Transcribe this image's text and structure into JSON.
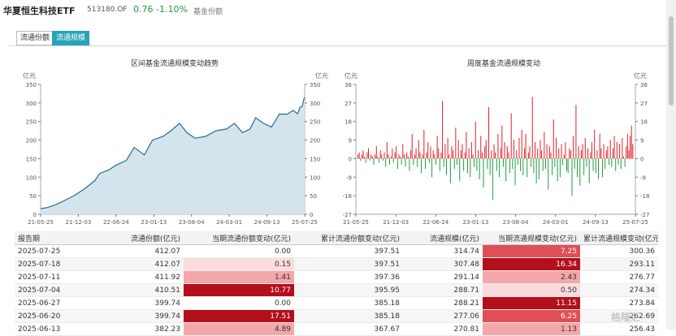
{
  "header": {
    "fund_name": "华夏恒生科技ETF",
    "code": "513180.OF",
    "price": "0.76",
    "change_pct": "-1.10%",
    "more_label": "基金份额"
  },
  "tabs": [
    {
      "label": "流通份额",
      "active": false
    },
    {
      "label": "流通规模",
      "active": true
    }
  ],
  "colors": {
    "accent": "#27a3b8",
    "up": "#e31b23",
    "down": "#1a9b3c",
    "area": "#d4e4ec",
    "line": "#2b6a92"
  },
  "chart_left": {
    "title": "区间基金流通规模变动趋势",
    "unit": "亿元",
    "y_ticks": [
      "350",
      "300",
      "250",
      "200",
      "150",
      "100",
      "50",
      "0"
    ],
    "x_ticks": [
      "21-05-25",
      "21-12-03",
      "22-06-24",
      "23-01-13",
      "23-08-04",
      "24-03-01",
      "24-09-13",
      "25-07-25"
    ]
  },
  "chart_right": {
    "title": "周度基金流通规模变动",
    "unit": "亿元",
    "y_ticks": [
      "36",
      "27",
      "18",
      "9",
      "0",
      "-9",
      "-18",
      "-27"
    ],
    "x_ticks": [
      "21-05-25",
      "21-12-03",
      "22-06-24",
      "23-01-13",
      "23-08-04",
      "24-03-01",
      "24-09-13",
      "25-07-25"
    ]
  },
  "chart_data": [
    {
      "type": "area",
      "title": "区间基金流通规模变动趋势",
      "ylabel": "亿元",
      "ylim": [
        0,
        350
      ],
      "x_range": [
        "21-05-25",
        "25-07-25"
      ],
      "points": [
        [
          "2021-05-25",
          15
        ],
        [
          "2021-07-01",
          18
        ],
        [
          "2021-08-15",
          25
        ],
        [
          "2021-10-01",
          35
        ],
        [
          "2021-12-03",
          50
        ],
        [
          "2022-02-01",
          68
        ],
        [
          "2022-04-01",
          90
        ],
        [
          "2022-05-01",
          110
        ],
        [
          "2022-06-24",
          120
        ],
        [
          "2022-08-01",
          132
        ],
        [
          "2022-10-01",
          145
        ],
        [
          "2022-11-15",
          180
        ],
        [
          "2023-01-13",
          160
        ],
        [
          "2023-03-01",
          200
        ],
        [
          "2023-05-01",
          210
        ],
        [
          "2023-06-15",
          225
        ],
        [
          "2023-08-04",
          245
        ],
        [
          "2023-09-15",
          220
        ],
        [
          "2023-11-01",
          205
        ],
        [
          "2024-01-01",
          210
        ],
        [
          "2024-03-01",
          225
        ],
        [
          "2024-05-01",
          230
        ],
        [
          "2024-06-15",
          245
        ],
        [
          "2024-08-01",
          220
        ],
        [
          "2024-09-13",
          230
        ],
        [
          "2024-10-15",
          260
        ],
        [
          "2024-12-01",
          245
        ],
        [
          "2025-01-15",
          235
        ],
        [
          "2025-03-01",
          270
        ],
        [
          "2025-04-15",
          270
        ],
        [
          "2025-05-20",
          280
        ],
        [
          "2025-06-13",
          271
        ],
        [
          "2025-06-20",
          277
        ],
        [
          "2025-06-27",
          288
        ],
        [
          "2025-07-04",
          289
        ],
        [
          "2025-07-11",
          291
        ],
        [
          "2025-07-18",
          307
        ],
        [
          "2025-07-25",
          315
        ]
      ]
    },
    {
      "type": "bar",
      "title": "周度基金流通规模变动",
      "ylabel": "亿元",
      "ylim": [
        -27,
        36
      ],
      "x_range": [
        "21-05-25",
        "25-07-25"
      ],
      "values": [
        2,
        3,
        -1,
        2,
        4,
        1,
        -2,
        3,
        5,
        -1,
        2,
        1,
        -3,
        2,
        6,
        1,
        -2,
        4,
        2,
        -1,
        3,
        -4,
        8,
        2,
        -3,
        1,
        5,
        -2,
        3,
        6,
        -5,
        2,
        1,
        -3,
        7,
        2,
        -4,
        3,
        1,
        -6,
        4,
        12,
        -3,
        2,
        5,
        -4,
        9,
        3,
        -7,
        2,
        14,
        -5,
        3,
        8,
        -2,
        6,
        -9,
        4,
        2,
        -3,
        11,
        5,
        -6,
        3,
        28,
        -4,
        7,
        -8,
        10,
        2,
        -12,
        6,
        4,
        -5,
        15,
        -3,
        9,
        -11,
        4,
        7,
        -6,
        3,
        13,
        -7,
        5,
        -9,
        8,
        2,
        -4,
        18,
        -6,
        4,
        -10,
        11,
        3,
        -14,
        6,
        9,
        -5,
        25,
        -8,
        4,
        -20,
        7,
        3,
        -6,
        12,
        -9,
        5,
        16,
        -4,
        8,
        -11,
        6,
        3,
        -7,
        22,
        -5,
        9,
        -13,
        4,
        -3,
        10,
        -6,
        14,
        -8,
        5,
        12,
        -9,
        3,
        6,
        -4,
        30,
        -7,
        8,
        -12,
        5,
        -10,
        9,
        4,
        -6,
        13,
        -5,
        7,
        -15,
        6,
        3,
        -8,
        19,
        -4,
        10,
        -11,
        5,
        -9,
        7,
        -3,
        2,
        8,
        -6,
        -7,
        5,
        4,
        -18,
        11,
        -5,
        26,
        -9,
        6,
        -13,
        4,
        7,
        -8,
        10,
        -4,
        5,
        -12,
        3,
        8,
        -6,
        14,
        -7,
        4,
        -10,
        12,
        5,
        -9,
        7,
        -5,
        4,
        6,
        -3,
        9,
        -4,
        5,
        11,
        -6,
        8,
        -3,
        7,
        -5,
        10,
        1,
        -4,
        6,
        12,
        4,
        11,
        16,
        7
      ]
    }
  ],
  "table": {
    "columns": [
      "报告期",
      "流通份额(亿元)",
      "当期流通份额变动(亿元)",
      "累计流通份额变动(亿元)",
      "流通规模(亿元)",
      "当期流通规模变动(亿元)",
      "累计流通规模变动(亿元)"
    ],
    "rows": [
      [
        "2025-07-25",
        "412.07",
        "0.00",
        "397.51",
        "314.74",
        "7.25",
        "300.36"
      ],
      [
        "2025-07-18",
        "412.07",
        "0.15",
        "397.51",
        "307.48",
        "16.34",
        "293.11"
      ],
      [
        "2025-07-11",
        "411.92",
        "1.41",
        "397.36",
        "291.14",
        "2.43",
        "276.77"
      ],
      [
        "2025-07-04",
        "410.51",
        "10.77",
        "395.95",
        "288.71",
        "0.50",
        "274.34"
      ],
      [
        "2025-06-27",
        "399.74",
        "0.00",
        "385.18",
        "288.21",
        "11.15",
        "273.84"
      ],
      [
        "2025-06-20",
        "399.74",
        "17.51",
        "385.18",
        "277.06",
        "6.25",
        "262.69"
      ],
      [
        "2025-06-13",
        "382.23",
        "4.89",
        "367.67",
        "270.81",
        "1.13",
        "256.43"
      ]
    ]
  },
  "watermark": "格隆汇"
}
